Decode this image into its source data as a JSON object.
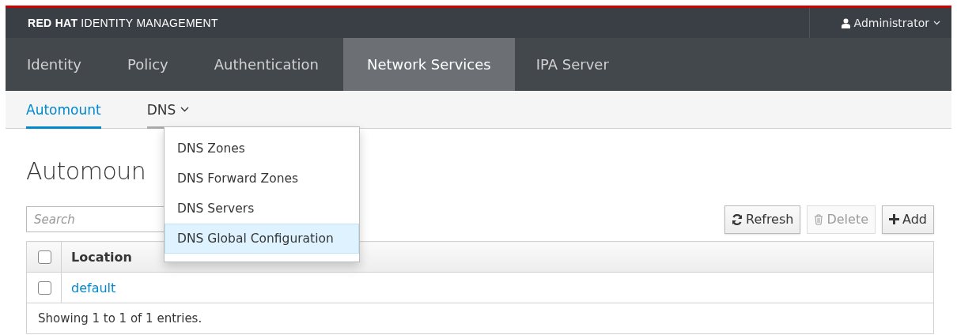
{
  "brand": {
    "bold": "RED HAT",
    "rest": "IDENTITY MANAGEMENT"
  },
  "user_menu": {
    "label": "Administrator"
  },
  "nav_tabs": [
    {
      "label": "Identity",
      "selected": false
    },
    {
      "label": "Policy",
      "selected": false
    },
    {
      "label": "Authentication",
      "selected": false
    },
    {
      "label": "Network Services",
      "selected": true
    },
    {
      "label": "IPA Server",
      "selected": false
    }
  ],
  "sub_tabs": [
    {
      "label": "Automount",
      "selected": true,
      "kind": "link",
      "expanded": false
    },
    {
      "label": "DNS",
      "selected": false,
      "kind": "menu",
      "expanded": true
    }
  ],
  "dropdown": {
    "items": [
      {
        "label": "DNS Zones",
        "selected": false
      },
      {
        "label": "DNS Forward Zones",
        "selected": false
      },
      {
        "label": "DNS Servers",
        "selected": false
      },
      {
        "label": "DNS Global Configuration",
        "selected": true
      }
    ]
  },
  "page_title": "Automoun",
  "search": {
    "placeholder": "Search"
  },
  "buttons": [
    {
      "label": "Refresh",
      "kind": "refresh",
      "disabled": false
    },
    {
      "label": "Delete",
      "kind": "delete",
      "disabled": true
    },
    {
      "label": "Add",
      "kind": "add",
      "disabled": false
    }
  ],
  "table": {
    "select_all": {
      "checked": false
    },
    "columns": [
      "Location"
    ],
    "rows": [
      {
        "location": "default",
        "checked": false
      }
    ],
    "footer": "Showing 1 to 1 of 1 entries."
  }
}
